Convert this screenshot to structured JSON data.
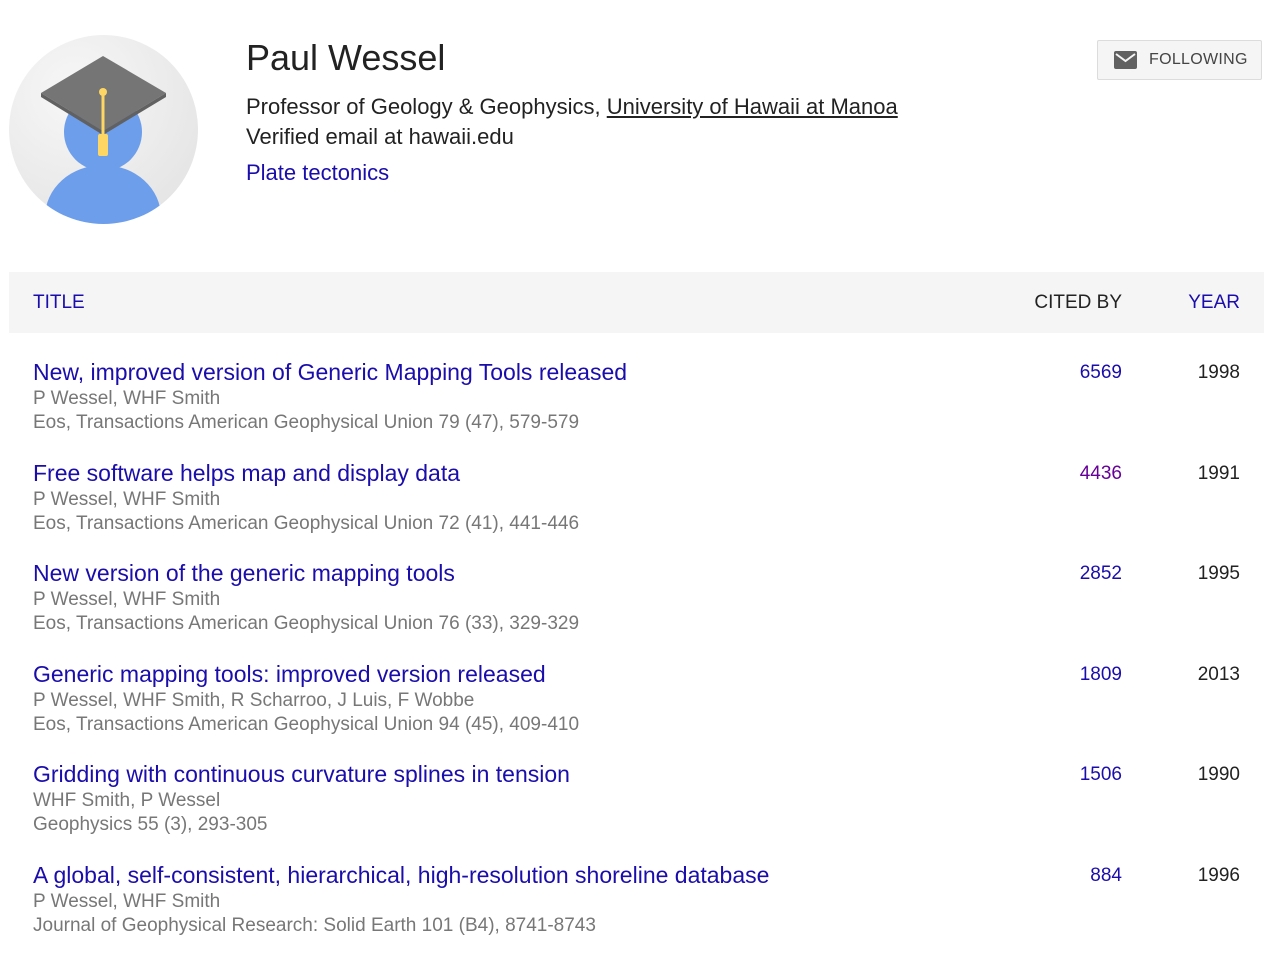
{
  "profile": {
    "name": "Paul Wessel",
    "position": "Professor of Geology & Geophysics, ",
    "institution": "University of Hawaii at Manoa",
    "email": "Verified email at hawaii.edu",
    "interests": [
      "Plate tectonics"
    ]
  },
  "follow_button": {
    "label": "FOLLOWING",
    "icon": "mail-icon"
  },
  "table": {
    "headers": {
      "title": "TITLE",
      "cited_by": "CITED BY",
      "year": "YEAR"
    },
    "rows": [
      {
        "title": "New, improved version of Generic Mapping Tools released",
        "authors": "P Wessel, WHF Smith",
        "venue": "Eos, Transactions American Geophysical Union 79 (47), 579-579",
        "cited_by": "6569",
        "year": "1998"
      },
      {
        "title": "Free software helps map and display data",
        "authors": "P Wessel, WHF Smith",
        "venue": "Eos, Transactions American Geophysical Union 72 (41), 441-446",
        "cited_by": "4436",
        "year": "1991"
      },
      {
        "title": "New version of the generic mapping tools",
        "authors": "P Wessel, WHF Smith",
        "venue": "Eos, Transactions American Geophysical Union 76 (33), 329-329",
        "cited_by": "2852",
        "year": "1995"
      },
      {
        "title": "Generic mapping tools: improved version released",
        "authors": "P Wessel, WHF Smith, R Scharroo, J Luis, F Wobbe",
        "venue": "Eos, Transactions American Geophysical Union 94 (45), 409-410",
        "cited_by": "1809",
        "year": "2013"
      },
      {
        "title": "Gridding with continuous curvature splines in tension",
        "authors": "WHF Smith, P Wessel",
        "venue": "Geophysics 55 (3), 293-305",
        "cited_by": "1506",
        "year": "1990"
      },
      {
        "title": "A global, self-consistent, hierarchical, high-resolution shoreline database",
        "authors": "P Wessel, WHF Smith",
        "venue": "Journal of Geophysical Research: Solid Earth 101 (B4), 8741-8743",
        "cited_by": "884",
        "year": "1996"
      }
    ]
  },
  "colors": {
    "link": "#1a0dab",
    "visited_link": "#660099",
    "meta_text": "#777777",
    "header_bg": "#f5f5f5",
    "avatar_bg": "#eeeeee",
    "avatar_person": "#6d9eeb",
    "cap_gray": "#757575",
    "tassel_yellow": "#fdd663"
  }
}
